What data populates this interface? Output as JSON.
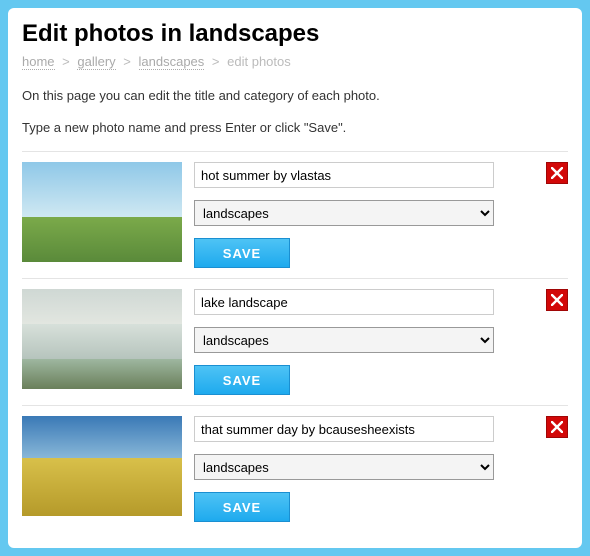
{
  "page": {
    "title": "Edit photos in landscapes"
  },
  "breadcrumb": {
    "items": [
      {
        "label": "home",
        "link": true
      },
      {
        "label": "gallery",
        "link": true
      },
      {
        "label": "landscapes",
        "link": true
      },
      {
        "label": "edit photos",
        "link": false
      }
    ],
    "separator": ">"
  },
  "intro": {
    "line1": "On this page you can edit the title and category of each photo.",
    "line2": "Type a new photo name and press Enter or click \"Save\"."
  },
  "category_options": [
    "landscapes"
  ],
  "buttons": {
    "save": "SAVE"
  },
  "photos": [
    {
      "title": "hot summer by vlastas",
      "category": "landscapes",
      "thumb_style": "summer"
    },
    {
      "title": "lake landscape",
      "category": "landscapes",
      "thumb_style": "lake"
    },
    {
      "title": "that summer day by bcausesheexists",
      "category": "landscapes",
      "thumb_style": "field"
    }
  ]
}
